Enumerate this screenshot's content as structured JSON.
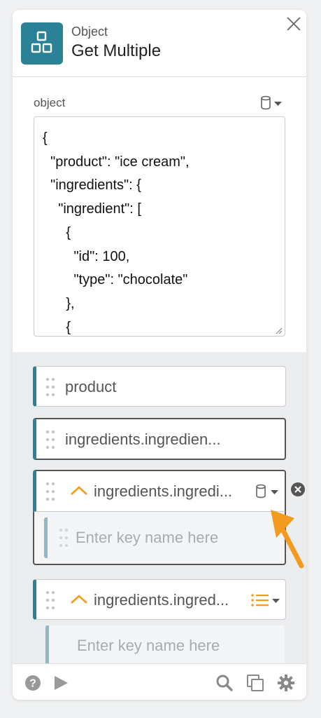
{
  "header": {
    "category": "Object",
    "title": "Get Multiple"
  },
  "object_field": {
    "label": "object",
    "json_lines": [
      "{",
      "  \"product\": \"ice cream\",",
      "  \"ingredients\": {",
      "    \"ingredient\": [",
      "      {",
      "        \"id\": 100,",
      "        \"type\": \"chocolate\"",
      "      },",
      "      {"
    ]
  },
  "keys": [
    {
      "label": "product"
    },
    {
      "label": "ingredients.ingredien..."
    },
    {
      "label": "ingredients.ingredi..."
    },
    {
      "label": "ingredients.ingred..."
    }
  ],
  "key_input": {
    "placeholder": "Enter key name here"
  },
  "colors": {
    "brand": "#2b8296",
    "accent_orange": "#f39a1f",
    "nested_bar": "#8fb8c4"
  },
  "icons": {
    "app": "object-blocks-icon",
    "close": "close-icon",
    "data_source": "database-icon",
    "list_type": "list-icon",
    "help": "help-icon",
    "run": "play-icon",
    "search": "search-icon",
    "copy": "copy-icon",
    "settings": "gear-icon"
  }
}
